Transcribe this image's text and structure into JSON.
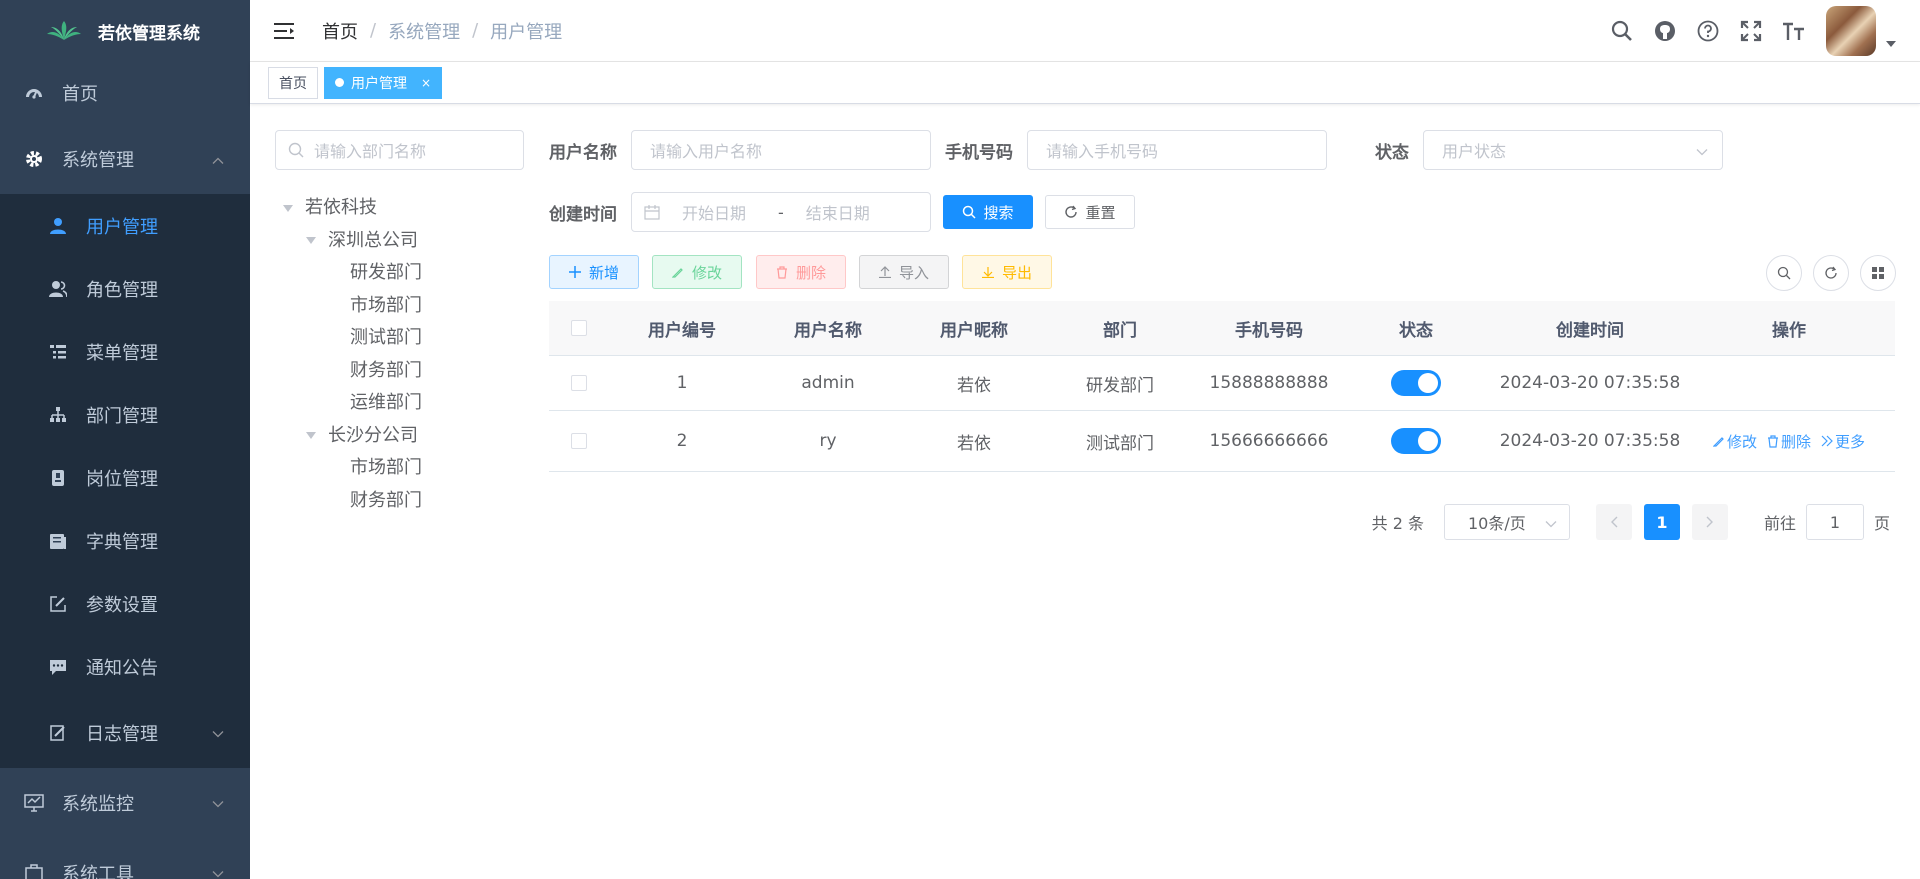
{
  "app": {
    "title": "若依管理系统"
  },
  "sidebar": {
    "items": [
      {
        "label": "首页"
      },
      {
        "label": "系统管理"
      },
      {
        "label": "系统监控"
      },
      {
        "label": "系统工具"
      }
    ],
    "sub_items": [
      {
        "label": "用户管理"
      },
      {
        "label": "角色管理"
      },
      {
        "label": "菜单管理"
      },
      {
        "label": "部门管理"
      },
      {
        "label": "岗位管理"
      },
      {
        "label": "字典管理"
      },
      {
        "label": "参数设置"
      },
      {
        "label": "通知公告"
      },
      {
        "label": "日志管理"
      }
    ]
  },
  "header": {
    "breadcrumb": [
      "首页",
      "系统管理",
      "用户管理"
    ]
  },
  "tags": [
    {
      "label": "首页"
    },
    {
      "label": "用户管理",
      "close": "×"
    }
  ],
  "tree": {
    "search_placeholder": "请输入部门名称",
    "nodes": [
      "若依科技",
      "深圳总公司",
      "研发部门",
      "市场部门",
      "测试部门",
      "财务部门",
      "运维部门",
      "长沙分公司",
      "市场部门",
      "财务部门"
    ]
  },
  "search": {
    "username_label": "用户名称",
    "username_placeholder": "请输入用户名称",
    "phone_label": "手机号码",
    "phone_placeholder": "请输入手机号码",
    "status_label": "状态",
    "status_placeholder": "用户状态",
    "created_label": "创建时间",
    "start_placeholder": "开始日期",
    "range_sep": "-",
    "end_placeholder": "结束日期",
    "search_btn": "搜索",
    "reset_btn": "重置"
  },
  "toolbar": {
    "add": "新增",
    "edit": "修改",
    "delete": "删除",
    "import": "导入",
    "export": "导出"
  },
  "table": {
    "columns": [
      "用户编号",
      "用户名称",
      "用户昵称",
      "部门",
      "手机号码",
      "状态",
      "创建时间",
      "操作"
    ],
    "rows": [
      {
        "id": "1",
        "username": "admin",
        "nickname": "若依",
        "dept": "研发部门",
        "phone": "15888888888",
        "status": true,
        "created": "2024-03-20 07:35:58",
        "ops": []
      },
      {
        "id": "2",
        "username": "ry",
        "nickname": "若依",
        "dept": "测试部门",
        "phone": "15666666666",
        "status": true,
        "created": "2024-03-20 07:35:58",
        "ops": [
          "修改",
          "删除",
          "更多"
        ]
      }
    ]
  },
  "pagination": {
    "total": "共 2 条",
    "page_size": "10条/页",
    "current": "1",
    "goto_label": "前往",
    "goto_value": "1",
    "page_suffix": "页"
  },
  "colors": {
    "primary": "#1890ff",
    "sidebar_bg": "#304156",
    "submenu_bg": "#1f2d3d",
    "active_text": "#409eff"
  }
}
